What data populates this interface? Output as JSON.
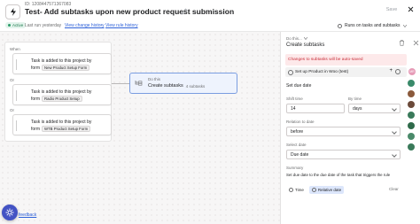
{
  "header": {
    "rule_id": "ID: 1208447571367083",
    "title": "Test- Add subtasks upon new product request submission",
    "save_label": "Save",
    "active_label": "Active",
    "last_run": "Last run yesterday",
    "view_change_history": "View change history",
    "view_rule_history": "View rule history",
    "runs_on": "Runs on tasks and subtasks"
  },
  "canvas": {
    "when_label": "When",
    "or_label": "Or",
    "triggers": [
      {
        "line1": "Task is added to this project by",
        "form_prefix": "form",
        "form_name": "New Product Setup Form"
      },
      {
        "line1": "Task is added to this project by",
        "form_prefix": "form",
        "form_name": "Radio Product Setup"
      },
      {
        "line1": "Task is added to this project by",
        "form_prefix": "form",
        "form_name": "WTB Product Setup Form"
      }
    ],
    "action": {
      "label": "Do this",
      "name": "Create subtasks",
      "count": "4 subtasks"
    },
    "feedback": "feedback"
  },
  "panel": {
    "do_this": "Do this...",
    "title": "Create subtasks",
    "warning": "Changes to subtasks will be auto-saved",
    "subtask": "Set up Product in Woo (test)",
    "subtask_avatar": "MR",
    "set_due_date": "Set due date",
    "shift_time_label": "Shift time",
    "shift_value": "14",
    "by_time_label": "By time",
    "by_time_value": "days",
    "relation_label": "Relation to date",
    "relation_value": "before",
    "select_date_label": "Select date",
    "select_date_value": "Due date",
    "summary_label": "Summary",
    "summary_text": "Set due date to the due date of the task that triggers the rule",
    "time_label": "Time",
    "relative_label": "Relative date",
    "clear_label": "Clear"
  },
  "colors": {
    "accent": "#4353c4",
    "link": "#2f62d9",
    "warning_bg": "#fde9ea",
    "action_bg": "#eef3fd"
  }
}
